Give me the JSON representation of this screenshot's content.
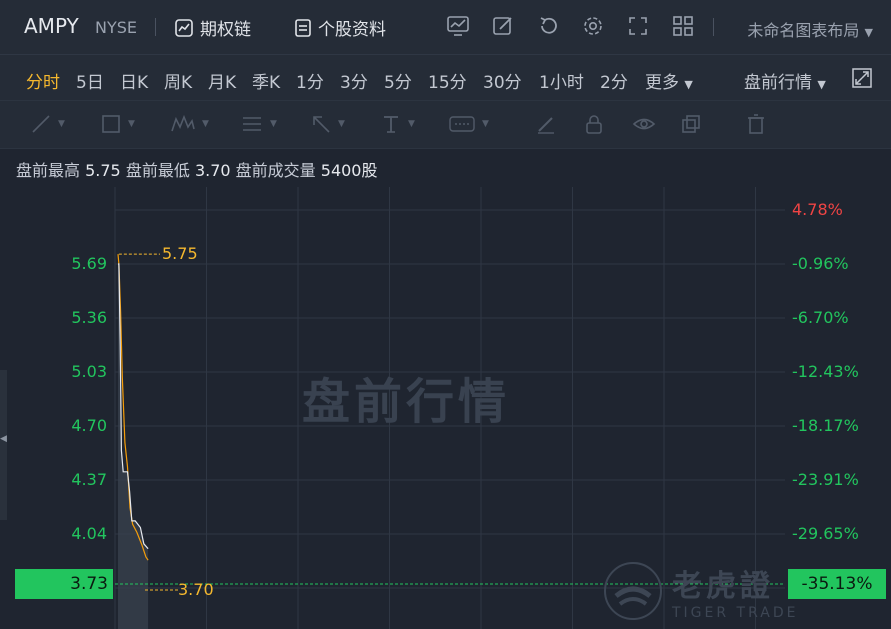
{
  "header": {
    "symbol": "AMPY",
    "exchange": "NYSE",
    "options_chain": "期权链",
    "profile": "个股资料",
    "layout_name": "未命名图表布局"
  },
  "periods": {
    "items": [
      "分时",
      "5日",
      "日K",
      "周K",
      "月K",
      "季K",
      "1分",
      "3分",
      "5分",
      "15分",
      "30分",
      "1小时",
      "2分"
    ],
    "more": "更多",
    "session": "盘前行情"
  },
  "info": {
    "high_label": "盘前最高",
    "high": "5.75",
    "low_label": "盘前最低",
    "low": "3.70",
    "vol_label": "盘前成交量",
    "vol": "5400股"
  },
  "chart_data": {
    "type": "line",
    "y_left": [
      "5.69",
      "5.36",
      "5.03",
      "4.70",
      "4.37",
      "4.04"
    ],
    "y_right": [
      "4.78%",
      "-0.96%",
      "-6.70%",
      "-12.43%",
      "-18.17%",
      "-23.91%",
      "-29.65%"
    ],
    "current_price": "3.73",
    "current_pct": "-35.13%",
    "max_label": "5.75",
    "min_label": "3.70",
    "price_line": [
      [
        0,
        5.69
      ],
      [
        0.2,
        5.69
      ],
      [
        0.5,
        5.2
      ],
      [
        0.8,
        4.55
      ],
      [
        1.2,
        4.42
      ],
      [
        2.2,
        4.42
      ],
      [
        2.7,
        4.3
      ],
      [
        3.2,
        4.12
      ],
      [
        4.0,
        4.12
      ],
      [
        5.2,
        4.08
      ],
      [
        6.0,
        3.98
      ],
      [
        7.0,
        3.95
      ]
    ],
    "avg_line": [
      [
        0,
        5.75
      ],
      [
        0.2,
        5.69
      ],
      [
        0.6,
        5.4
      ],
      [
        1.0,
        5.0
      ],
      [
        1.6,
        4.6
      ],
      [
        2.2,
        4.45
      ],
      [
        2.8,
        4.2
      ],
      [
        3.4,
        4.1
      ],
      [
        4.4,
        4.05
      ],
      [
        5.6,
        3.97
      ],
      [
        6.5,
        3.9
      ],
      [
        7.0,
        3.88
      ]
    ],
    "watermark": "盘前行情"
  },
  "brand": {
    "cn": "老虎證",
    "en": "TIGER TRADE"
  },
  "colors": {
    "up_green": "#22c55e",
    "accent": "#f5b82e",
    "red": "#ef4444"
  }
}
